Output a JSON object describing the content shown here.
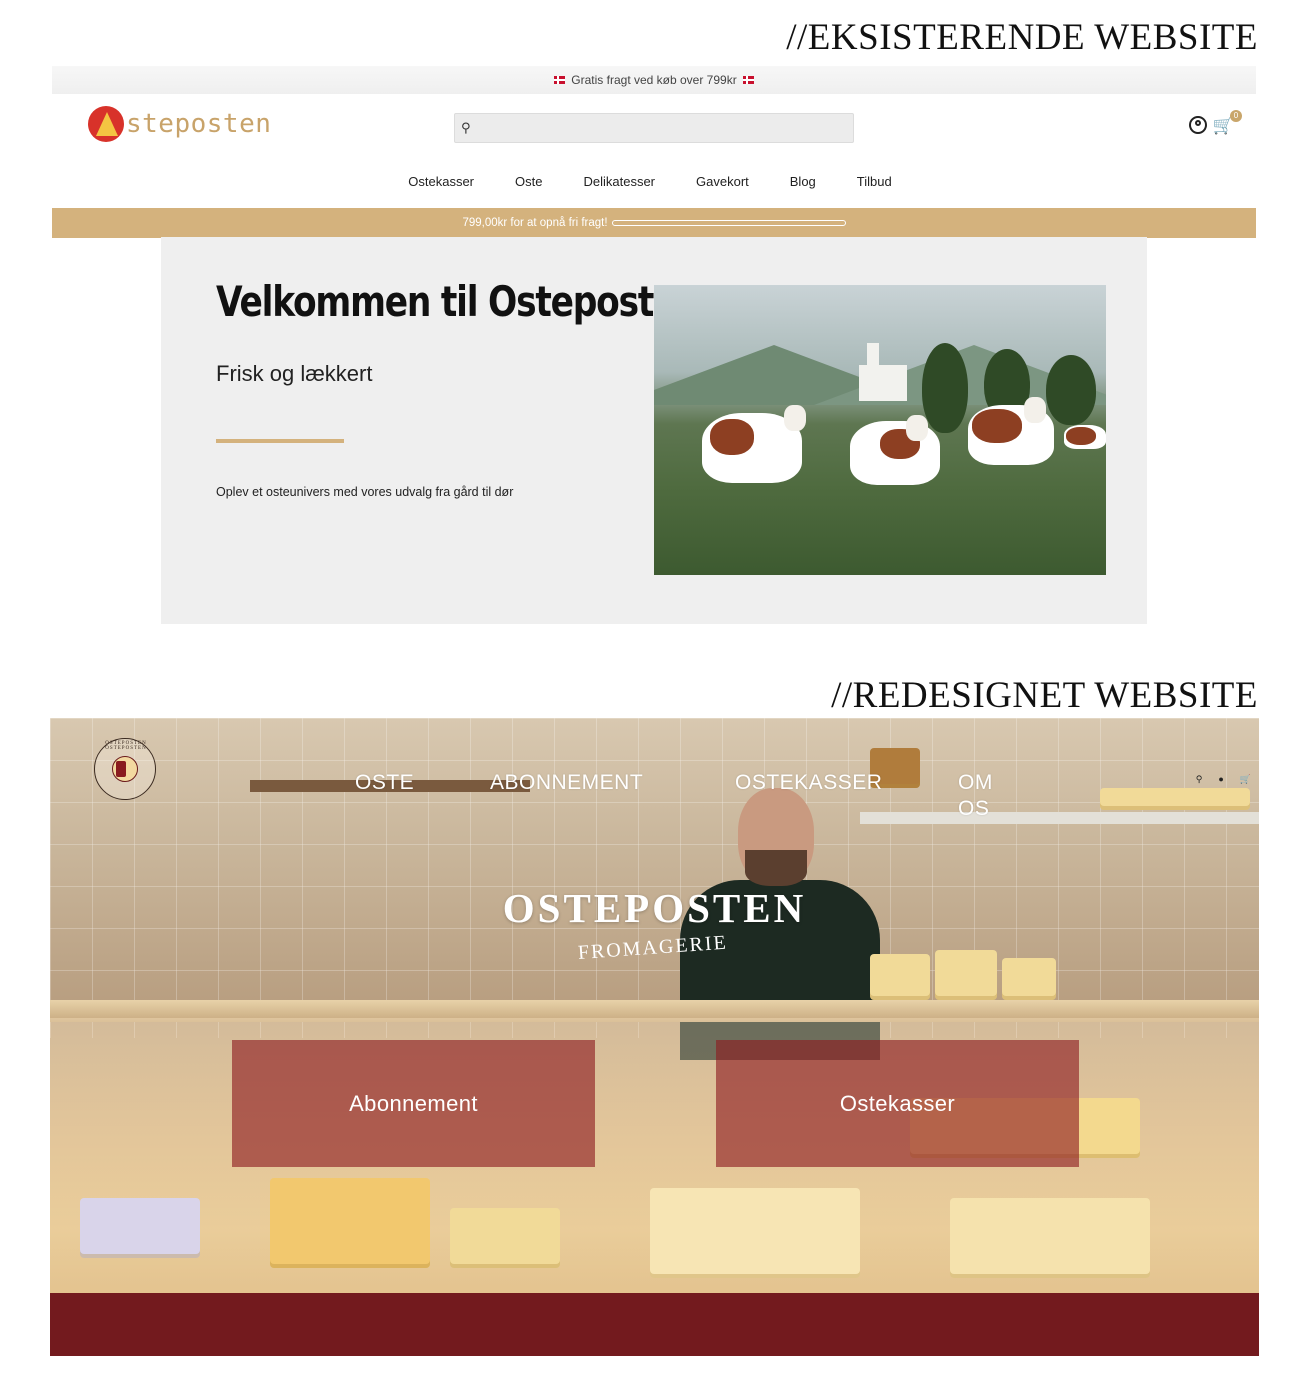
{
  "headings": {
    "existing": "//EKSISTERENDE WEBSITE",
    "redesigned": "//REDESIGNET WEBSITE"
  },
  "existing_site": {
    "topbar_text": "Gratis fragt ved køb over 799kr",
    "logo_text": "steposten",
    "search_placeholder": "",
    "cart_count": "0",
    "nav": [
      "Ostekasser",
      "Oste",
      "Delikatesser",
      "Gavekort",
      "Blog",
      "Tilbud"
    ],
    "shipping_text": "799,00kr for at opnå fri fragt!",
    "shipping_progress": 0,
    "hero": {
      "title": "Velkommen til Osteposten",
      "subtitle": "Frisk og lækkert",
      "body": "Oplev et osteunivers med vores udvalg fra gård til dør"
    }
  },
  "redesigned_site": {
    "logo_ring_text": "OSTEPOSTEN OSTEPOSTEN",
    "nav": [
      "OSTE",
      "ABONNEMENT",
      "OSTEKASSER",
      "OM OS"
    ],
    "brand": "OSTEPOSTEN",
    "brand_sub": "FROMAGERIE",
    "cta": [
      "Abonnement",
      "Ostekasser"
    ],
    "colors": {
      "accent": "#731a1e",
      "cta_overlay": "#8c1a20"
    }
  },
  "colors": {
    "gold": "#d4b27d",
    "text": "#111111"
  }
}
